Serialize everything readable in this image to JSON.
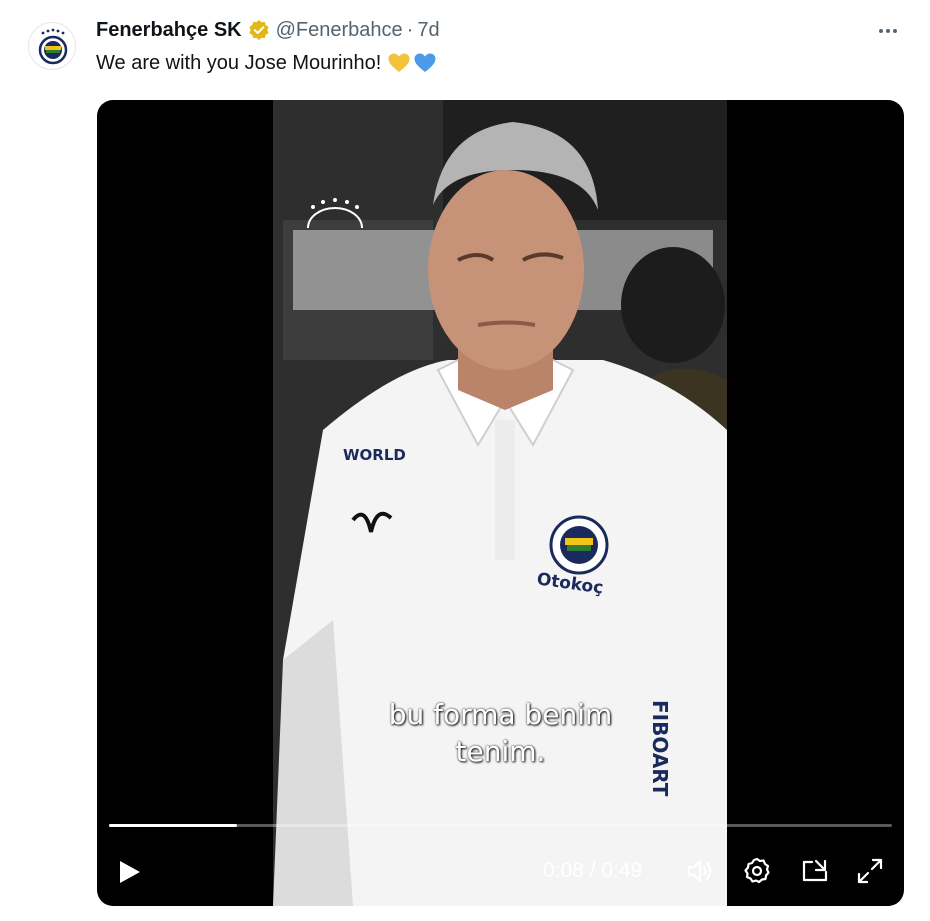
{
  "tweet": {
    "display_name": "Fenerbahçe SK",
    "handle": "@Fenerbahce",
    "separator": "·",
    "time": "7d",
    "text": "We are with you Jose Mourinho!",
    "emojis": [
      "yellow-heart",
      "blue-heart"
    ]
  },
  "video": {
    "subtitle_line1": "bu forma benim",
    "subtitle_line2": "tenim.",
    "current_time": "0:08",
    "duration": "0:49",
    "timecode": "0:08 / 0:49",
    "progress": 0.163
  },
  "colors": {
    "verified_badge": "#e2b719",
    "yellow_heart": "#f5c33b",
    "blue_heart": "#4c9be8",
    "club_navy": "#1b2a5c",
    "club_yellow": "#f0c419"
  },
  "icons": {
    "verified": "verified-badge-icon",
    "more": "more-icon",
    "play": "play-icon",
    "volume": "volume-icon",
    "settings": "settings-icon",
    "pip": "picture-in-picture-icon",
    "fullscreen": "fullscreen-icon"
  }
}
